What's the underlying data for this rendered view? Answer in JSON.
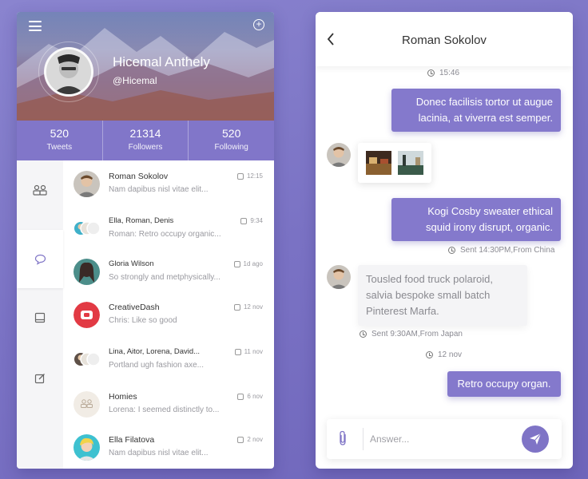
{
  "profile": {
    "name": "Hicemal Anthely",
    "handle": "@Hicemal",
    "stats": [
      {
        "value": "520",
        "label": "Tweets"
      },
      {
        "value": "21314",
        "label": "Followers"
      },
      {
        "value": "520",
        "label": "Following"
      }
    ]
  },
  "side_nav": [
    "contacts-icon",
    "chat-icon",
    "book-icon",
    "edit-icon"
  ],
  "conversations": [
    {
      "name": "Roman Sokolov",
      "snippet": "Nam dapibus nisl vitae elit...",
      "time": "12:15"
    },
    {
      "name": "Ella, Roman, Denis",
      "snippet": "Roman: Retro occupy organic...",
      "time": "9:34"
    },
    {
      "name": "Gloria Wilson",
      "snippet": "So strongly and metphysically...",
      "time": "1d ago"
    },
    {
      "name": "CreativeDash",
      "snippet": "Chris: Like so good",
      "time": "12 nov"
    },
    {
      "name": "Lina, Aitor, Lorena, David...",
      "snippet": "Portland ugh fashion axe...",
      "time": "11 nov"
    },
    {
      "name": "Homies",
      "snippet": "Lorena: I seemed distinctly to...",
      "time": "6 nov"
    },
    {
      "name": "Ella Filatova",
      "snippet": "Nam dapibus nisl vitae elit...",
      "time": "2 nov"
    }
  ],
  "chat": {
    "title": "Roman Sokolov",
    "time1": "15:46",
    "msg1_l1": "Donec facilisis tortor ut augue",
    "msg1_l2": "lacinia, at viverra est semper.",
    "msg2_l1": "Kogi Cosby sweater ethical",
    "msg2_l2": "squid irony disrupt, organic.",
    "sent1": "Sent 14:30PM,From China",
    "msg3_l1": "Tousled food truck polaroid,",
    "msg3_l2": "salvia bespoke small batch",
    "msg3_l3": "Pinterest Marfa.",
    "sent2": "Sent 9:30AM,From Japan",
    "time2": "12 nov",
    "msg4": "Retro occupy organ.",
    "input_placeholder": "Answer..."
  },
  "colors": {
    "accent": "#8479cc",
    "background": "#7a72c4"
  }
}
